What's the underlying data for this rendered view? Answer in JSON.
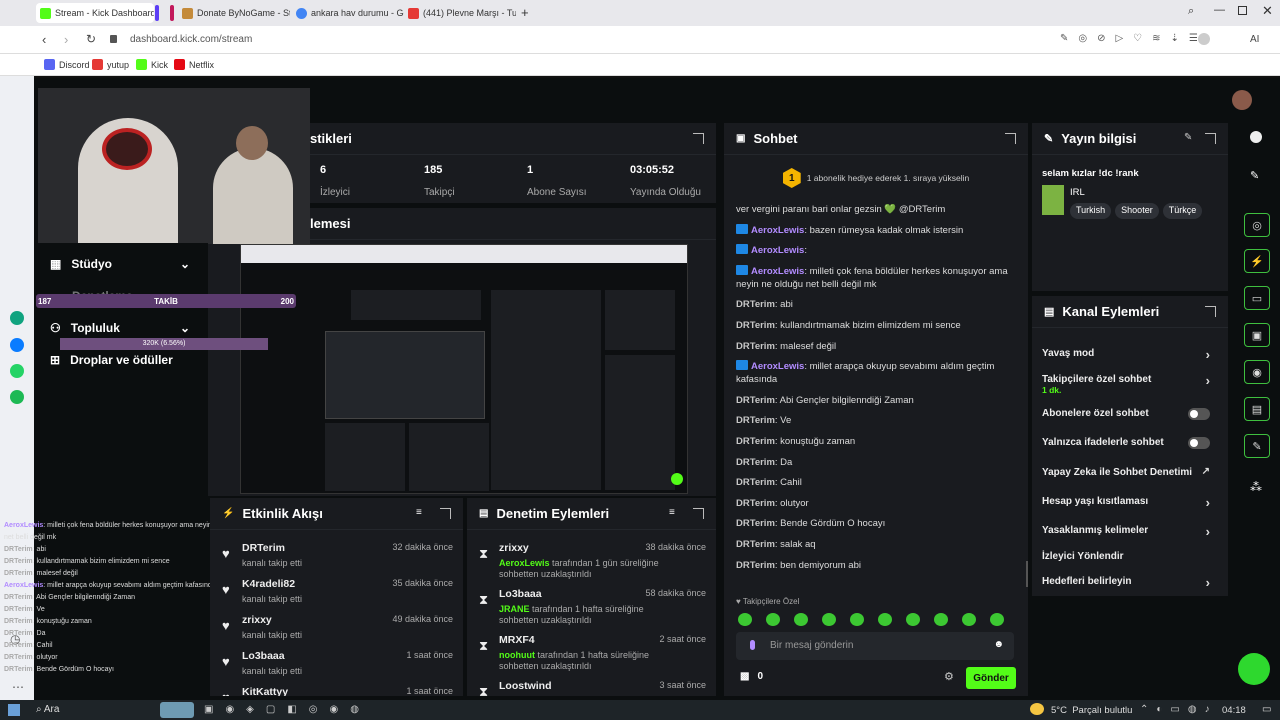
{
  "browser": {
    "tabs": [
      {
        "title": "Stream - Kick Dashboard",
        "color": "#53fc18"
      },
      {
        "title": "Donate ByNoGame - Strea",
        "color": "#c48a3a"
      },
      {
        "title": "ankara hav durumu - Goo",
        "color": "#4285f4"
      },
      {
        "title": "(441) Plevne Marşı - Tuna",
        "color": "#e53935"
      }
    ],
    "url": "dashboard.kick.com/stream",
    "ai_label": "AI",
    "bookmarks": [
      {
        "label": "Discord",
        "color": "#5865f2"
      },
      {
        "label": "yutup",
        "color": "#e53935"
      },
      {
        "label": "Kick",
        "color": "#53fc18"
      },
      {
        "label": "Netflix",
        "color": "#e50914"
      }
    ]
  },
  "stats": {
    "title_partial": "stikleri",
    "items": [
      {
        "value": "6",
        "label": "İzleyici"
      },
      {
        "value": "185",
        "label": "Takipçi"
      },
      {
        "value": "1",
        "label": "Abone Sayısı"
      },
      {
        "value": "03:05:52",
        "label": "Yayında Olduğu"
      }
    ]
  },
  "preview": {
    "title_partial": "lemesi"
  },
  "left_menu": {
    "studio": "Stüdyo",
    "community": "Topluluk",
    "rewards": "Droplar ve ödüller",
    "overlap_text": "Denetleme"
  },
  "follower_goal": {
    "current": "187",
    "label": "TAKİB",
    "target": "200",
    "sub": "320K (6.56%)"
  },
  "chat": {
    "title": "Sohbet",
    "hype_rank": "1",
    "hype_text": "1 abonelik hediye ederek 1. sıraya yükselin",
    "messages": [
      {
        "user": "",
        "text": "ver vergini paranı bari onlar gezsin 💚 @DRTerim",
        "verified": false,
        "color": ""
      },
      {
        "user": "AeroxLewis",
        "text": ": bazen rümeysa kadak olmak istersin",
        "verified": true,
        "color": "purple"
      },
      {
        "user": "AeroxLewis",
        "text": ":",
        "verified": true,
        "color": "purple"
      },
      {
        "user": "AeroxLewis",
        "text": ": milleti çok fena böldüler herkes konuşuyor ama neyin ne olduğu net belli değil mk",
        "verified": true,
        "color": "purple"
      },
      {
        "user": "DRTerim",
        "text": ": abi",
        "verified": false,
        "color": ""
      },
      {
        "user": "DRTerim",
        "text": ": kullandırtmamak bizim elimizdem mi sence",
        "verified": false,
        "color": ""
      },
      {
        "user": "DRTerim",
        "text": ": malesef değil",
        "verified": false,
        "color": ""
      },
      {
        "user": "AeroxLewis",
        "text": ": millet arapça okuyup sevabımı aldım geçtim kafasında",
        "verified": true,
        "color": "purple"
      },
      {
        "user": "DRTerim",
        "text": ": Abi Gençler bilgilenndiği Zaman",
        "verified": false,
        "color": ""
      },
      {
        "user": "DRTerim",
        "text": ": Ve",
        "verified": false,
        "color": ""
      },
      {
        "user": "DRTerim",
        "text": ": konuştuğu zaman",
        "verified": false,
        "color": ""
      },
      {
        "user": "DRTerim",
        "text": ": Da",
        "verified": false,
        "color": ""
      },
      {
        "user": "DRTerim",
        "text": ": Cahil",
        "verified": false,
        "color": ""
      },
      {
        "user": "DRTerim",
        "text": ": olutyor",
        "verified": false,
        "color": ""
      },
      {
        "user": "DRTerim",
        "text": ": Bende Gördüm O hocayı",
        "verified": false,
        "color": ""
      },
      {
        "user": "DRTerim",
        "text": ": salak aq",
        "verified": false,
        "color": ""
      },
      {
        "user": "DRTerim",
        "text": ": ben demiyorum abi",
        "verified": false,
        "color": ""
      }
    ],
    "emote_category": "Takipçilere Özel",
    "input_placeholder": "Bir mesaj gönderin",
    "points": "0",
    "send": "Gönder"
  },
  "stream_info": {
    "title": "Yayın bilgisi",
    "stream_title": "selam kızlar !dc !rank",
    "category": "IRL",
    "tags": [
      "Turkish",
      "Shooter",
      "Türkçe"
    ]
  },
  "channel_actions": {
    "title": "Kanal Eylemleri",
    "items": [
      {
        "label": "Yavaş mod",
        "type": "chevron",
        "sub": ""
      },
      {
        "label": "Takipçilere özel sohbet",
        "type": "chevron",
        "sub": "1 dk."
      },
      {
        "label": "Abonelere özel sohbet",
        "type": "toggle",
        "sub": ""
      },
      {
        "label": "Yalnızca ifadelerle sohbet",
        "type": "toggle",
        "sub": ""
      },
      {
        "label": "Yapay Zeka ile Sohbet Denetimi",
        "type": "external",
        "sub": ""
      },
      {
        "label": "Hesap yaşı kısıtlaması",
        "type": "chevron",
        "sub": ""
      },
      {
        "label": "Yasaklanmış kelimeler",
        "type": "chevron",
        "sub": ""
      },
      {
        "label": "İzleyici Yönlendir",
        "type": "none",
        "sub": ""
      },
      {
        "label": "Hedefleri belirleyin",
        "type": "chevron",
        "sub": ""
      }
    ]
  },
  "activity": {
    "title": "Etkinlik Akışı",
    "items": [
      {
        "name": "DRTerim",
        "sub": "kanalı takip etti",
        "time": "32 dakika önce"
      },
      {
        "name": "K4radeli82",
        "sub": "kanalı takip etti",
        "time": "35 dakika önce"
      },
      {
        "name": "zrixxy",
        "sub": "kanalı takip etti",
        "time": "49 dakika önce"
      },
      {
        "name": "Lo3baaa",
        "sub": "kanalı takip etti",
        "time": "1 saat önce"
      },
      {
        "name": "KitKattyy",
        "sub": "",
        "time": "1 saat önce"
      }
    ]
  },
  "moderation": {
    "title": "Denetim Eylemleri",
    "items": [
      {
        "name": "zrixxy",
        "actor": "AeroxLewis",
        "desc": " tarafından 1 gün süreliğine sohbetten uzaklaştırıldı",
        "time": "38 dakika önce"
      },
      {
        "name": "Lo3baaa",
        "actor": "JRANE",
        "desc": " tarafından 1 hafta süreliğine sohbetten uzaklaştırıldı",
        "time": "58 dakika önce"
      },
      {
        "name": "MRXF4",
        "actor": "noohuut",
        "desc": " tarafından 1 hafta süreliğine sohbetten uzaklaştırıldı",
        "time": "2 saat önce"
      },
      {
        "name": "Loostwind",
        "actor": "",
        "desc": "",
        "time": "3 saat önce"
      }
    ]
  },
  "chat_overlay": [
    {
      "user": "AeroxLewis",
      "text": ": milleti çok fena böldüler herkes konuşuyor ama neyin ne olduğu"
    },
    {
      "user": "",
      "text": "net belli değil mk"
    },
    {
      "user": "DRTerim",
      "text": ": abi"
    },
    {
      "user": "DRTerim",
      "text": ": kullandırtmamak bizim elimizdem mi sence"
    },
    {
      "user": "DRTerim",
      "text": ": malesef değil"
    },
    {
      "user": "AeroxLewis",
      "text": ": millet arapça okuyup sevabımı aldım geçtim kafasında"
    },
    {
      "user": "DRTerim",
      "text": ": Abi Gençler bilgilenndiği Zaman"
    },
    {
      "user": "DRTerim",
      "text": ": Ve"
    },
    {
      "user": "DRTerim",
      "text": ": konuştuğu zaman"
    },
    {
      "user": "DRTerim",
      "text": ": Da"
    },
    {
      "user": "DRTerim",
      "text": ": Cahil"
    },
    {
      "user": "DRTerim",
      "text": ": olutyor"
    },
    {
      "user": "DRTerim",
      "text": ": Bende Gördüm O hocayı"
    }
  ],
  "taskbar": {
    "search": "Ara",
    "weather": "5°C  Parçalı bulutlu",
    "time": "04:18"
  },
  "colors": {
    "kick_green": "#53fc18",
    "panel": "#191b1f",
    "bg": "#0b0e0f"
  }
}
